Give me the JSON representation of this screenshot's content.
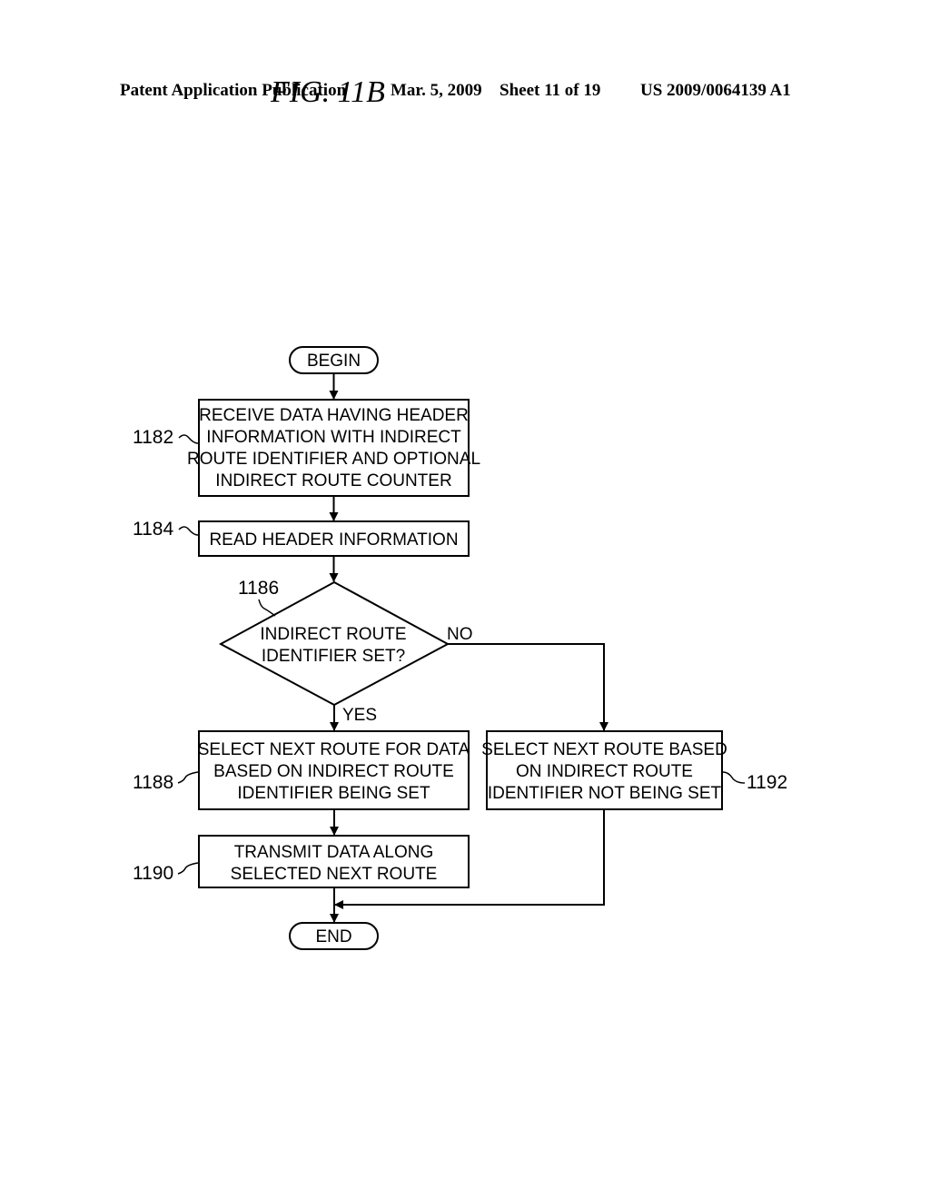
{
  "header": {
    "publication": "Patent Application Publication",
    "date": "Mar. 5, 2009",
    "sheet": "Sheet 11 of 19",
    "number": "US 2009/0064139 A1"
  },
  "figure": {
    "title": "FIG. 11B",
    "begin": "BEGIN",
    "end": "END",
    "steps": {
      "s1182": {
        "ref": "1182",
        "lines": [
          "RECEIVE DATA HAVING HEADER",
          "INFORMATION WITH INDIRECT",
          "ROUTE IDENTIFIER AND OPTIONAL",
          "INDIRECT ROUTE COUNTER"
        ]
      },
      "s1184": {
        "ref": "1184",
        "lines": [
          "READ HEADER INFORMATION"
        ]
      },
      "s1186": {
        "ref": "1186",
        "lines": [
          "INDIRECT ROUTE",
          "IDENTIFIER SET?"
        ],
        "yes": "YES",
        "no": "NO"
      },
      "s1188": {
        "ref": "1188",
        "lines": [
          "SELECT NEXT ROUTE FOR DATA",
          "BASED ON INDIRECT ROUTE",
          "IDENTIFIER BEING SET"
        ]
      },
      "s1190": {
        "ref": "1190",
        "lines": [
          "TRANSMIT DATA ALONG",
          "SELECTED NEXT ROUTE"
        ]
      },
      "s1192": {
        "ref": "1192",
        "lines": [
          "SELECT NEXT ROUTE BASED",
          "ON INDIRECT ROUTE",
          "IDENTIFIER NOT BEING SET"
        ]
      }
    }
  }
}
